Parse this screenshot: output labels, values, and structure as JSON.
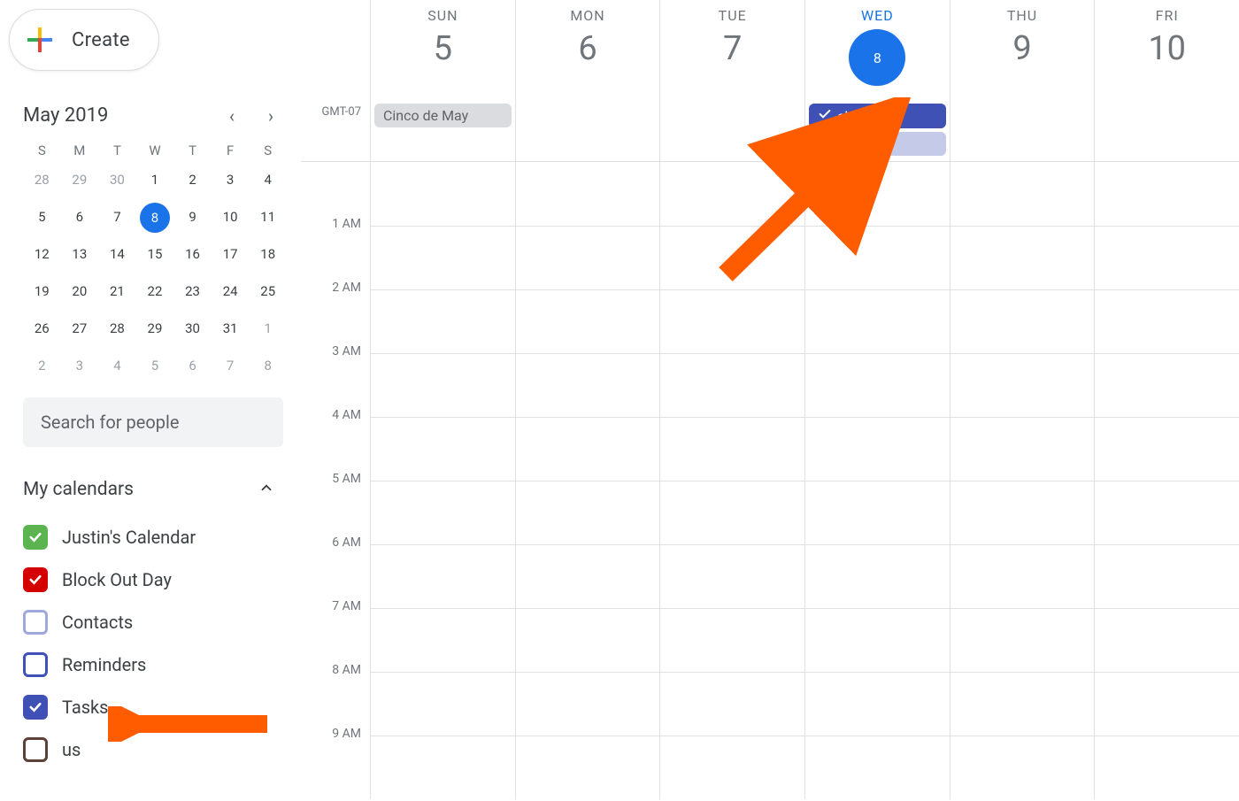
{
  "sidebar": {
    "create_label": "Create",
    "mini_cal": {
      "title": "May 2019",
      "dow": [
        "S",
        "M",
        "T",
        "W",
        "T",
        "F",
        "S"
      ],
      "weeks": [
        [
          {
            "n": "28",
            "dim": true
          },
          {
            "n": "29",
            "dim": true
          },
          {
            "n": "30",
            "dim": true
          },
          {
            "n": "1"
          },
          {
            "n": "2"
          },
          {
            "n": "3"
          },
          {
            "n": "4"
          }
        ],
        [
          {
            "n": "5"
          },
          {
            "n": "6"
          },
          {
            "n": "7"
          },
          {
            "n": "8",
            "today": true
          },
          {
            "n": "9"
          },
          {
            "n": "10"
          },
          {
            "n": "11"
          }
        ],
        [
          {
            "n": "12"
          },
          {
            "n": "13"
          },
          {
            "n": "14"
          },
          {
            "n": "15"
          },
          {
            "n": "16"
          },
          {
            "n": "17"
          },
          {
            "n": "18"
          }
        ],
        [
          {
            "n": "19"
          },
          {
            "n": "20"
          },
          {
            "n": "21"
          },
          {
            "n": "22"
          },
          {
            "n": "23"
          },
          {
            "n": "24"
          },
          {
            "n": "25"
          }
        ],
        [
          {
            "n": "26"
          },
          {
            "n": "27"
          },
          {
            "n": "28"
          },
          {
            "n": "29"
          },
          {
            "n": "30"
          },
          {
            "n": "31"
          },
          {
            "n": "1",
            "dim": true
          }
        ],
        [
          {
            "n": "2",
            "dim": true
          },
          {
            "n": "3",
            "dim": true
          },
          {
            "n": "4",
            "dim": true
          },
          {
            "n": "5",
            "dim": true
          },
          {
            "n": "6",
            "dim": true
          },
          {
            "n": "7",
            "dim": true
          },
          {
            "n": "8",
            "dim": true
          }
        ]
      ]
    },
    "search_placeholder": "Search for people",
    "my_calendars_title": "My calendars",
    "calendars": [
      {
        "name": "Justin's Calendar",
        "color": "#5bb450",
        "checked": true
      },
      {
        "name": "Block Out Day",
        "color": "#d50000",
        "checked": true
      },
      {
        "name": "Contacts",
        "color": "#9fa8da",
        "checked": false
      },
      {
        "name": "Reminders",
        "color": "#3f51b5",
        "checked": false
      },
      {
        "name": "Tasks",
        "color": "#3f51b5",
        "checked": true
      },
      {
        "name": "us",
        "color": "#5d4037",
        "checked": false
      }
    ]
  },
  "grid": {
    "tz": "GMT-07",
    "days": [
      {
        "dow": "SUN",
        "num": "5"
      },
      {
        "dow": "MON",
        "num": "6"
      },
      {
        "dow": "TUE",
        "num": "7"
      },
      {
        "dow": "WED",
        "num": "8",
        "today": true
      },
      {
        "dow": "THU",
        "num": "9"
      },
      {
        "dow": "FRI",
        "num": "10"
      }
    ],
    "allday": {
      "sun": "Cinco de May",
      "wed_task": "clean the",
      "wed_done": "This is a t"
    },
    "hours": [
      "",
      "1 AM",
      "2 AM",
      "3 AM",
      "4 AM",
      "5 AM",
      "6 AM",
      "7 AM",
      "8 AM",
      "9 AM"
    ]
  }
}
